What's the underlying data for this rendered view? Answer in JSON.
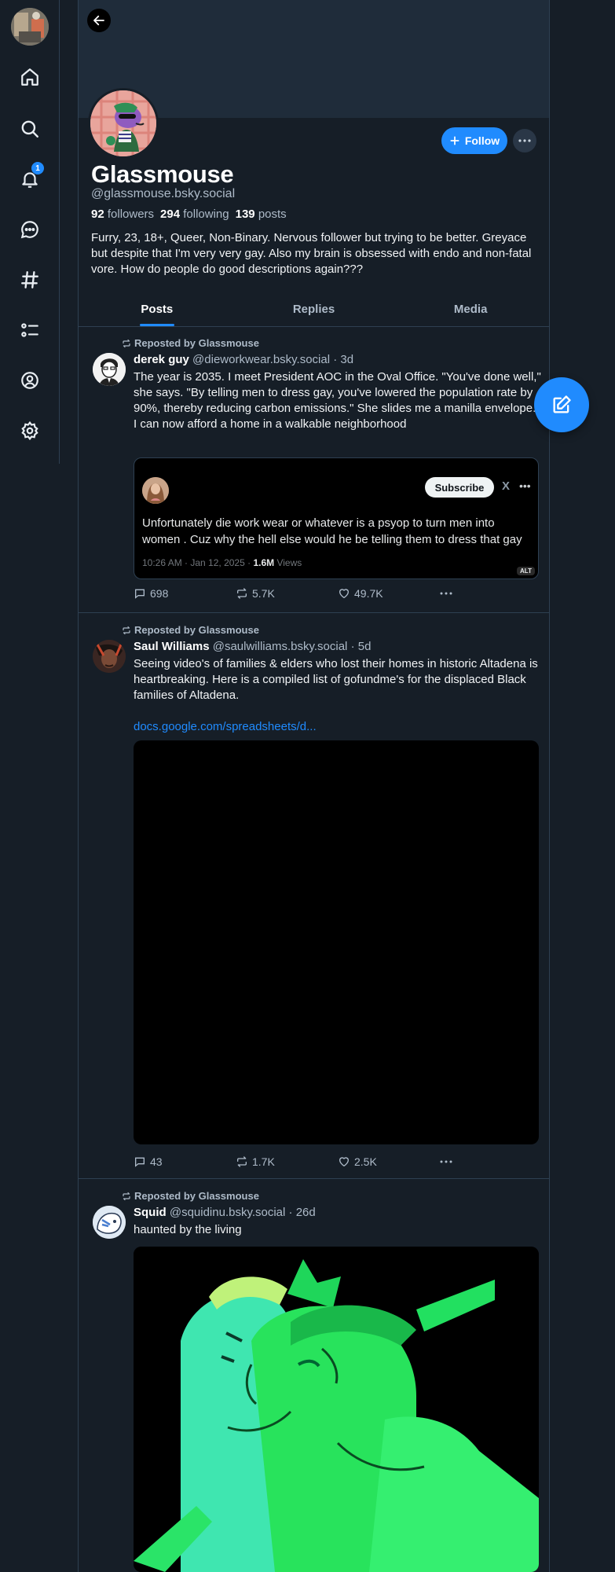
{
  "nav": {
    "notification_count": "1",
    "items": [
      "home",
      "search",
      "notifications",
      "chat",
      "feeds",
      "lists",
      "profile",
      "settings"
    ]
  },
  "profile": {
    "display_name": "Glassmouse",
    "handle": "@glassmouse.bsky.social",
    "followers_count": "92",
    "followers_label": "followers",
    "following_count": "294",
    "following_label": "following",
    "posts_count": "139",
    "posts_label": "posts",
    "bio": "Furry, 23, 18+, Queer, Non-Binary. Nervous follower but trying to be better. Greyace but despite that I'm very very gay. Also my brain is obsessed with endo and non-fatal vore. How do people do good descriptions again???",
    "follow_label": "Follow"
  },
  "tabs": [
    {
      "label": "Posts",
      "active": true
    },
    {
      "label": "Replies",
      "active": false
    },
    {
      "label": "Media",
      "active": false
    }
  ],
  "posts": [
    {
      "repost_label": "Reposted by Glassmouse",
      "author": "derek guy",
      "handle": "@dieworkwear.bsky.social",
      "time": "· 3d",
      "text": "The year is 2035. I meet President AOC in the Oval Office. \"You've done well,\" she says. \"By telling men to dress gay, you've lowered the population rate by 90%, thereby reducing carbon emissions.\" She slides me a manilla envelope. I can now afford a home in a walkable neighborhood",
      "embed": {
        "subscribe_label": "Subscribe",
        "x_glyph": "X",
        "text": "Unfortunately die work wear or whatever is a psyop to turn men into women . Cuz why the hell else would he be telling them to dress that gay",
        "meta_time": "10:26 AM · Jan 12, 2025 ·",
        "meta_views": "1.6M",
        "meta_views_label": "Views",
        "alt_label": "ALT"
      },
      "replies": "698",
      "reposts": "5.7K",
      "likes": "49.7K"
    },
    {
      "repost_label": "Reposted by Glassmouse",
      "author": "Saul Williams",
      "handle": "@saulwilliams.bsky.social",
      "time": "· 5d",
      "text": "Seeing video's of families & elders who lost their homes in historic Altadena is heartbreaking. Here is a compiled list of gofundme's for the displaced Black families of Altadena.",
      "link": "docs.google.com/spreadsheets/d...",
      "replies": "43",
      "reposts": "1.7K",
      "likes": "2.5K"
    },
    {
      "repost_label": "Reposted by Glassmouse",
      "author": "Squid",
      "handle": "@squidinu.bsky.social",
      "time": "· 26d",
      "text": "haunted by the living"
    }
  ],
  "colors": {
    "background": "#161e27",
    "accent": "#208bfe",
    "border": "#2e4052",
    "muted_text": "#aebbc9"
  }
}
